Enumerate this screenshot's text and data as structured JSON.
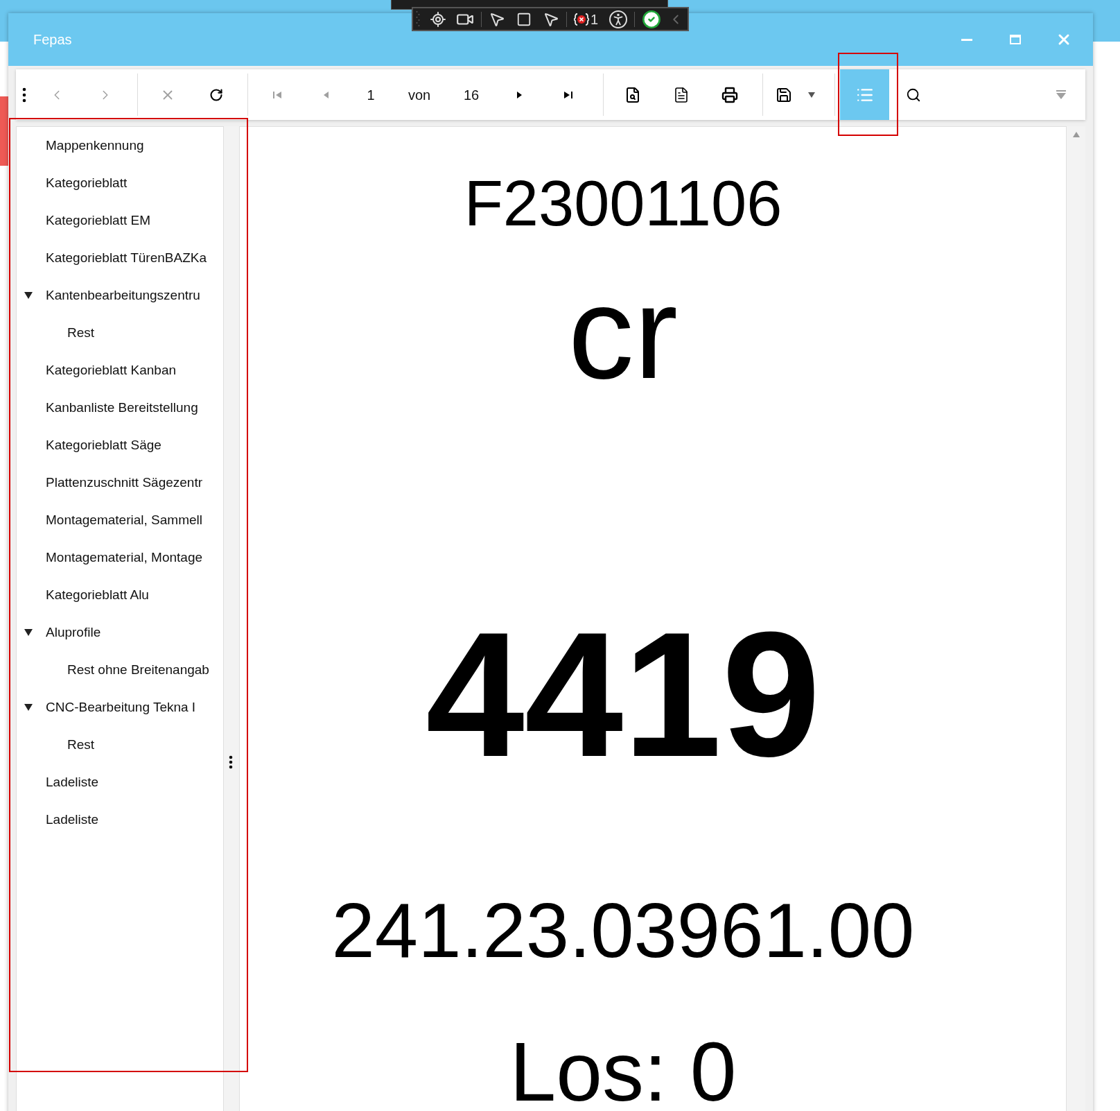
{
  "debug_toolbar": {
    "error_count": "1"
  },
  "window": {
    "title": "Fepas"
  },
  "toolbar": {
    "items": [
      {
        "kind": "menu",
        "disabled": false,
        "selected": false
      },
      {
        "kind": "back",
        "disabled": true,
        "selected": false
      },
      {
        "kind": "forward",
        "disabled": true,
        "selected": false
      },
      {
        "kind": "separator"
      },
      {
        "kind": "stop",
        "disabled": true,
        "selected": false
      },
      {
        "kind": "refresh",
        "disabled": false,
        "selected": false
      },
      {
        "kind": "separator"
      },
      {
        "kind": "first",
        "disabled": true,
        "selected": false
      },
      {
        "kind": "previous",
        "disabled": true,
        "selected": false
      },
      {
        "kind": "page-field",
        "value": "1"
      },
      {
        "kind": "label",
        "text": "von"
      },
      {
        "kind": "label",
        "text": "16"
      },
      {
        "kind": "next",
        "disabled": false,
        "selected": false
      },
      {
        "kind": "last",
        "disabled": false,
        "selected": false
      },
      {
        "kind": "separator"
      },
      {
        "kind": "page-setup",
        "disabled": false,
        "selected": false
      },
      {
        "kind": "document",
        "disabled": false,
        "selected": false
      },
      {
        "kind": "print",
        "disabled": false,
        "selected": false
      },
      {
        "kind": "separator"
      },
      {
        "kind": "save",
        "disabled": false,
        "selected": false
      },
      {
        "kind": "dropdown",
        "disabled": false,
        "selected": false
      },
      {
        "kind": "separator"
      },
      {
        "kind": "outline",
        "disabled": false,
        "selected": true
      },
      {
        "kind": "search",
        "disabled": false,
        "selected": false
      },
      {
        "kind": "spacer"
      },
      {
        "kind": "filter",
        "disabled": true,
        "selected": false
      }
    ]
  },
  "tree": [
    {
      "label": "Mappenkennung"
    },
    {
      "label": "Kategorieblatt"
    },
    {
      "label": "Kategorieblatt EM"
    },
    {
      "label": "Kategorieblatt TürenBAZKa"
    },
    {
      "label": "Kantenbearbeitungszentru",
      "expanded": true,
      "children": [
        {
          "label": "Rest"
        }
      ]
    },
    {
      "label": "Kategorieblatt Kanban"
    },
    {
      "label": "Kanbanliste Bereitstellung"
    },
    {
      "label": "Kategorieblatt Säge"
    },
    {
      "label": "Plattenzuschnitt Sägezentr"
    },
    {
      "label": "Montagematerial, Sammell"
    },
    {
      "label": "Montagematerial, Montage"
    },
    {
      "label": "Kategorieblatt Alu"
    },
    {
      "label": "Aluprofile",
      "expanded": true,
      "children": [
        {
          "label": "Rest ohne Breitenangab"
        }
      ]
    },
    {
      "label": "CNC-Bearbeitung Tekna I",
      "expanded": true,
      "children": [
        {
          "label": "Rest"
        }
      ]
    },
    {
      "label": "Ladeliste"
    },
    {
      "label": "Ladeliste"
    }
  ],
  "document": {
    "lines": [
      "F23001106",
      "cr",
      "4419",
      "241.23.03961.00",
      "Los: 0"
    ]
  }
}
